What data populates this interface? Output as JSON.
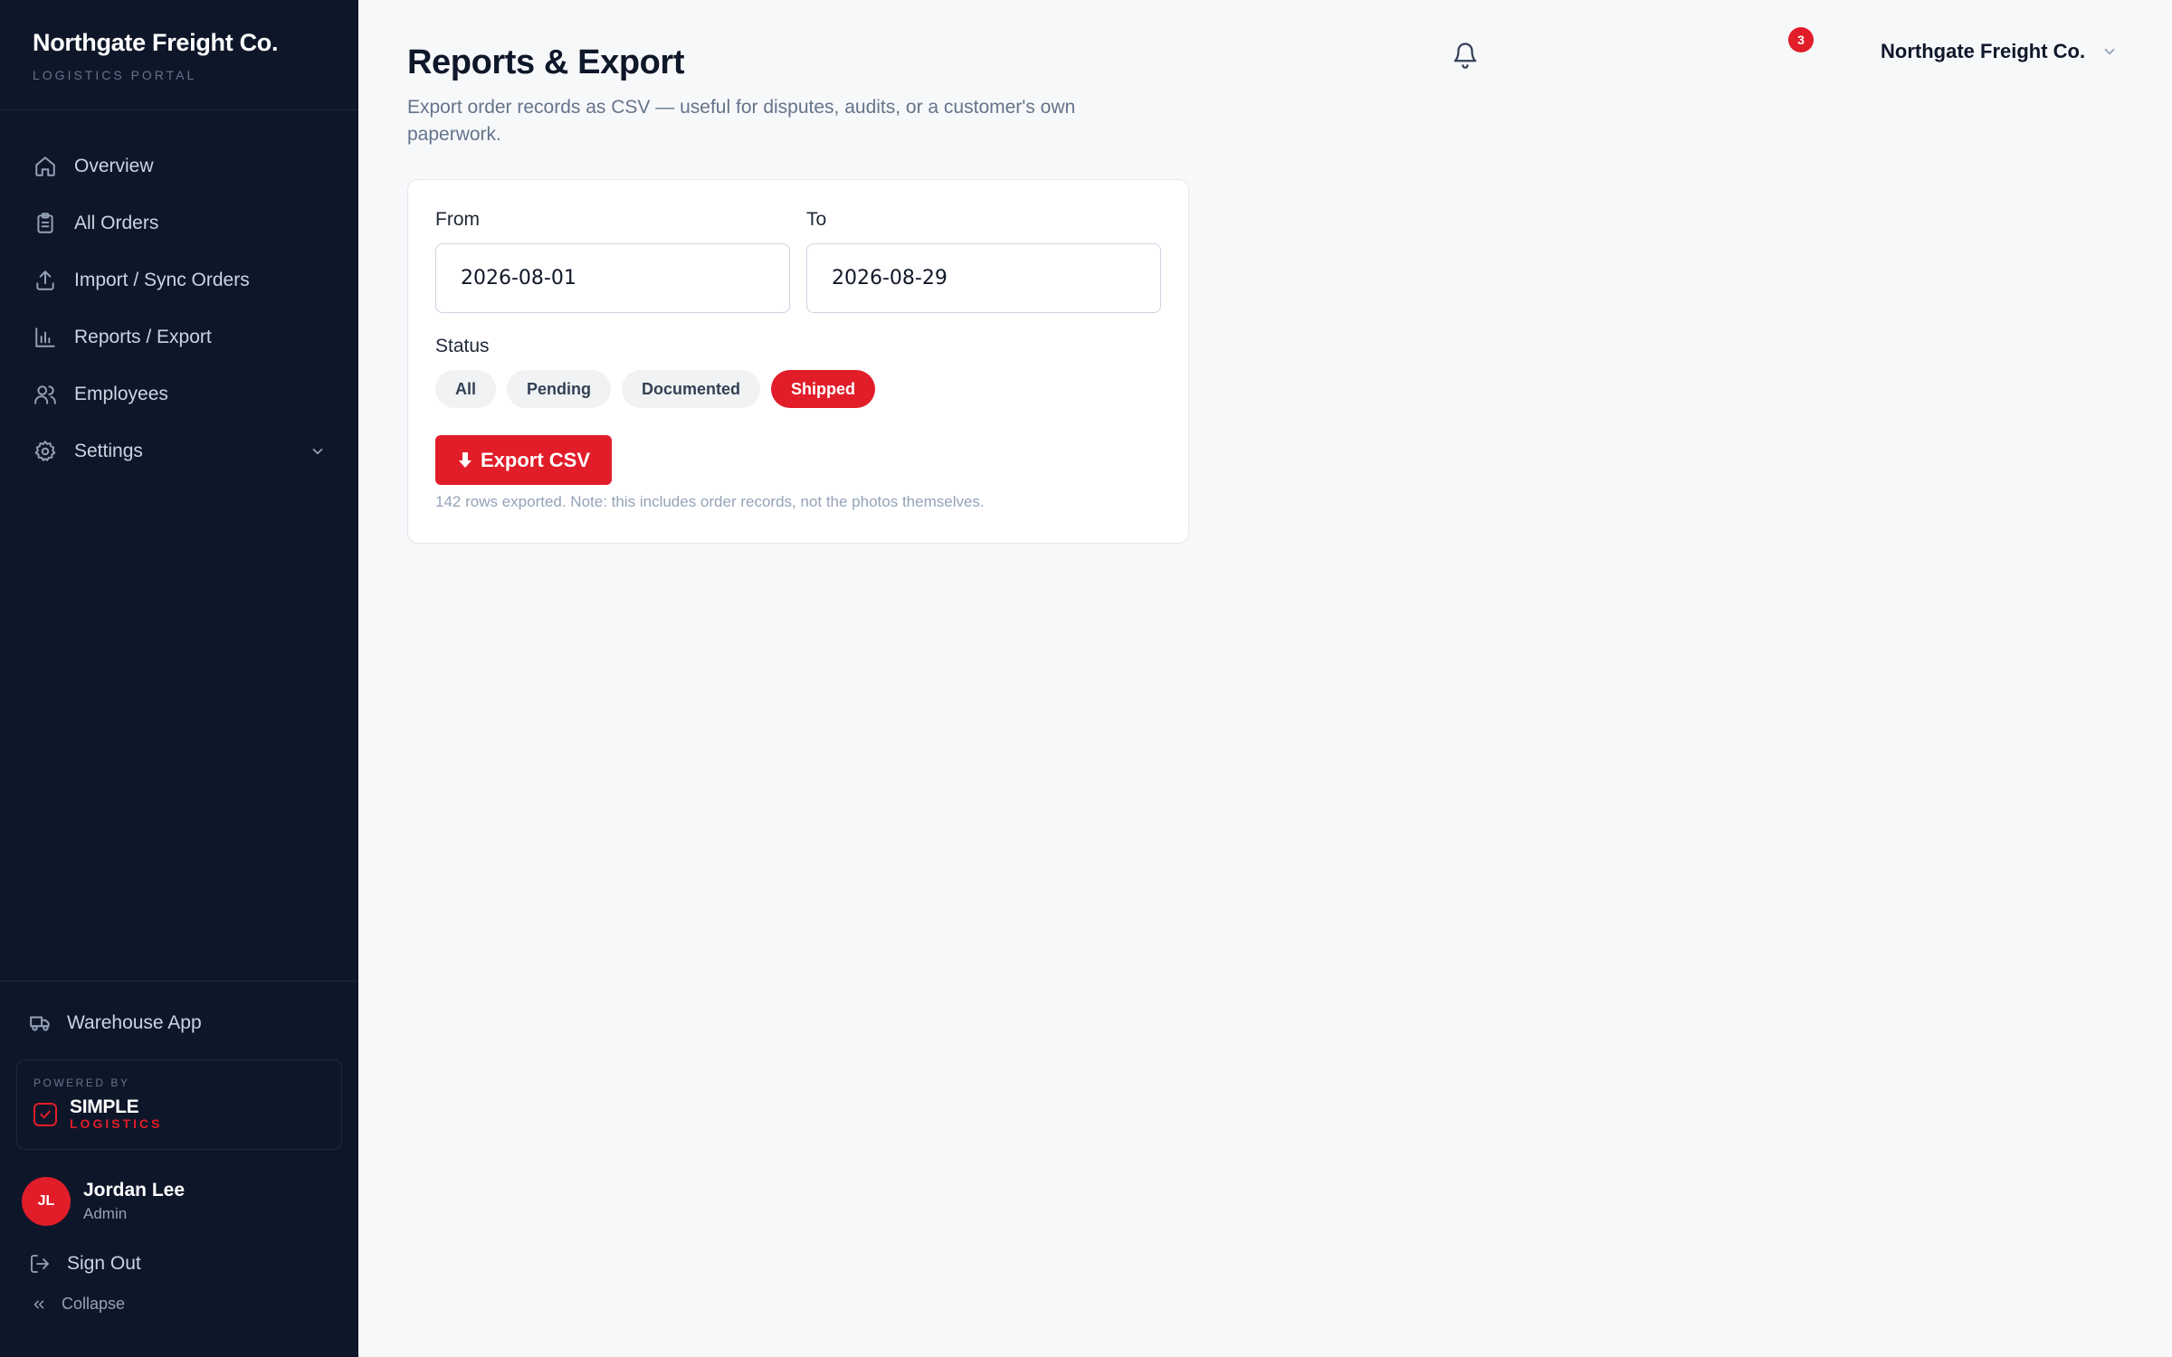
{
  "brand": {
    "name": "Northgate Freight Co.",
    "subtitle": "LOGISTICS PORTAL"
  },
  "nav": [
    {
      "label": "Overview",
      "icon": "home-icon"
    },
    {
      "label": "All Orders",
      "icon": "clipboard-icon"
    },
    {
      "label": "Import / Sync Orders",
      "icon": "upload-icon"
    },
    {
      "label": "Reports / Export",
      "icon": "bar-chart-icon"
    },
    {
      "label": "Employees",
      "icon": "users-icon"
    },
    {
      "label": "Settings",
      "icon": "gear-icon"
    }
  ],
  "sidebar_bottom": {
    "warehouse_app": "Warehouse App",
    "powered_by": "POWERED BY",
    "logo_top": "SIMPLE",
    "logo_bottom": "LOGISTICS",
    "user": {
      "initials": "JL",
      "name": "Jordan Lee",
      "role": "Admin"
    },
    "sign_out": "Sign Out",
    "collapse": "Collapse"
  },
  "header": {
    "notification_count": "3",
    "org_name": "Northgate Freight Co."
  },
  "page": {
    "title": "Reports & Export",
    "description": "Export order records as CSV — useful for disputes, audits, or a customer's own paperwork."
  },
  "form": {
    "from_label": "From",
    "from_value": "2026-08-01",
    "to_label": "To",
    "to_value": "2026-08-29",
    "status_label": "Status",
    "statuses": [
      "All",
      "Pending",
      "Documented",
      "Shipped"
    ],
    "selected_status": "Shipped",
    "export_label": "Export CSV",
    "note": "142 rows exported. Note: this includes order records, not the photos themselves."
  },
  "colors": {
    "accent": "#e11d2a",
    "sidebar": "#0e1729",
    "background": "#f7f8fa"
  }
}
